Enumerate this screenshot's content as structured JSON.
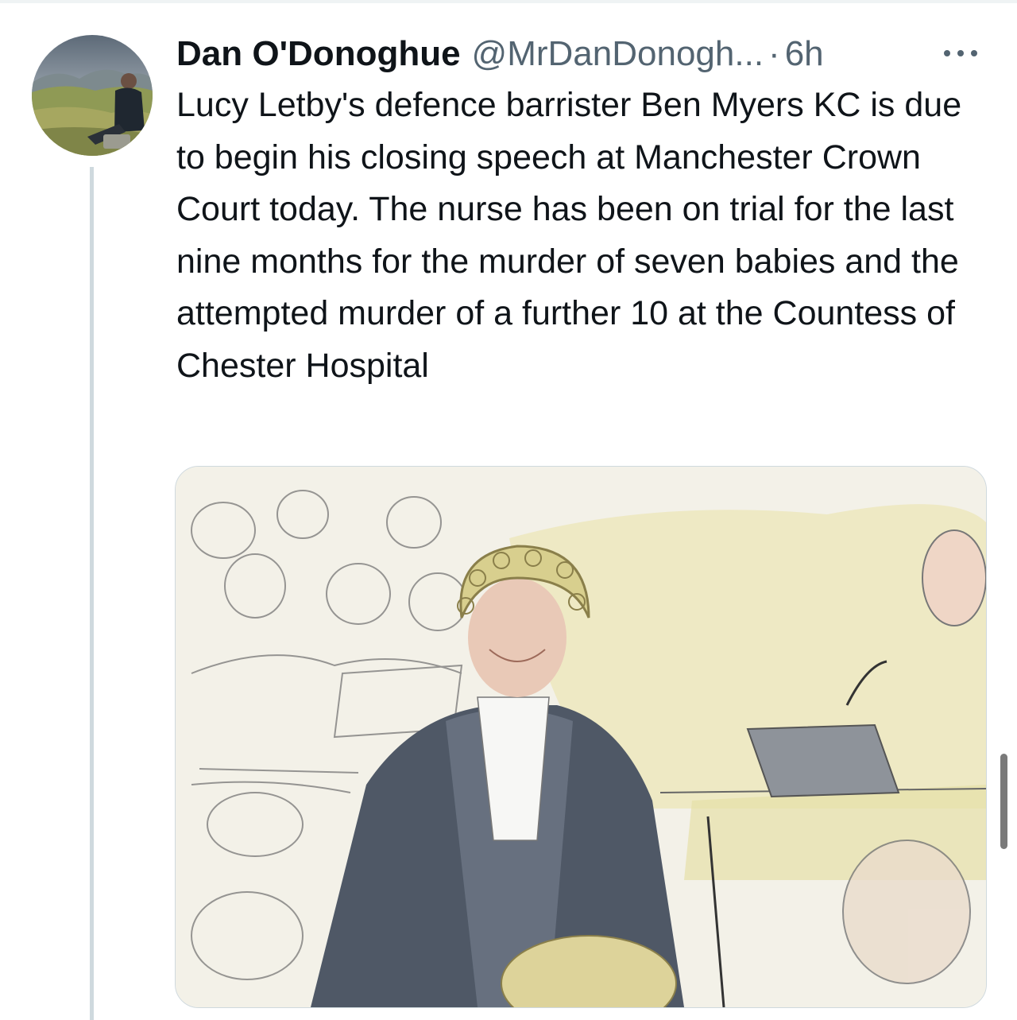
{
  "tweet": {
    "author": {
      "display_name": "Dan O'Donoghue",
      "handle": "@MrDanDonogh...",
      "avatar_icon": "profile-photo-icon"
    },
    "separator": "·",
    "time": "6h",
    "more_icon": "more-horizontal-icon",
    "text": "Lucy Letby's defence barrister Ben Myers KC is due to begin his closing speech at Manchester Crown Court today. The nurse has been on trial for the last nine months for the murder of seven babies and the attempted murder of a further 10 at the Countess of Chester Hospital",
    "media": {
      "type": "image",
      "icon": "courtroom-sketch-image"
    }
  },
  "colors": {
    "text_primary": "#0f1419",
    "text_secondary": "#536471",
    "thread_line": "#cfd9de"
  }
}
